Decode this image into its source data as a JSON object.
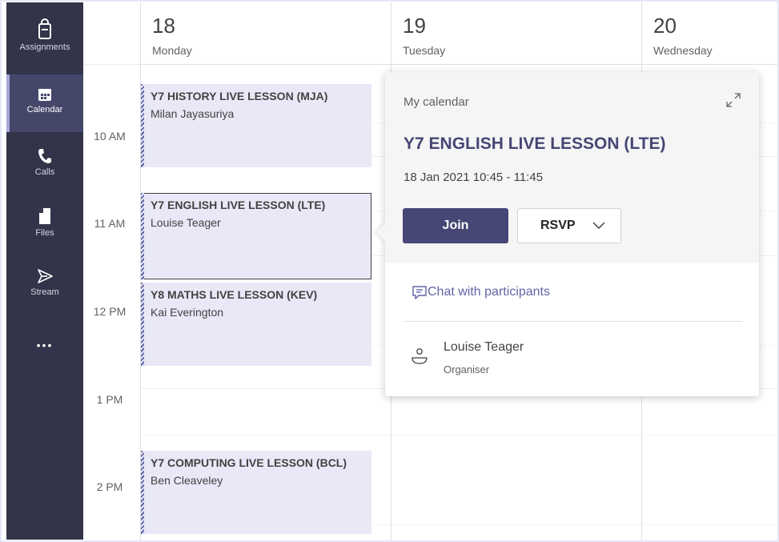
{
  "sidebar": {
    "items": [
      {
        "label": "Assignments",
        "icon": "assignments-icon"
      },
      {
        "label": "Calendar",
        "icon": "calendar-icon"
      },
      {
        "label": "Calls",
        "icon": "phone-icon"
      },
      {
        "label": "Files",
        "icon": "file-icon"
      },
      {
        "label": "Stream",
        "icon": "stream-icon"
      }
    ],
    "more": "•••",
    "active_color": "#44466a",
    "bg_color": "#33344a"
  },
  "days": [
    {
      "num": "18",
      "name": "Monday"
    },
    {
      "num": "19",
      "name": "Tuesday"
    },
    {
      "num": "20",
      "name": "Wednesday"
    }
  ],
  "times": [
    "10 AM",
    "11 AM",
    "12 PM",
    "1 PM",
    "2 PM"
  ],
  "events": [
    {
      "title": "Y7 HISTORY LIVE LESSON (MJA)",
      "organiser": "Milan Jayasuriya"
    },
    {
      "title": "Y7 ENGLISH LIVE LESSON (LTE)",
      "organiser": "Louise Teager"
    },
    {
      "title": "Y8 MATHS LIVE LESSON (KEV)",
      "organiser": "Kai Everington"
    },
    {
      "title": "Y7 COMPUTING LIVE LESSON (BCL)",
      "organiser": "Ben Cleaveley"
    }
  ],
  "popup": {
    "calendar_name": "My calendar",
    "title": "Y7 ENGLISH LIVE LESSON (LTE)",
    "datetime": "18 Jan 2021 10:45 - 11:45",
    "join_label": "Join",
    "rsvp_label": "RSVP",
    "chat_label": "Chat with participants",
    "organiser_name": "Louise Teager",
    "organiser_role": "Organiser",
    "accent_color": "#464775"
  }
}
